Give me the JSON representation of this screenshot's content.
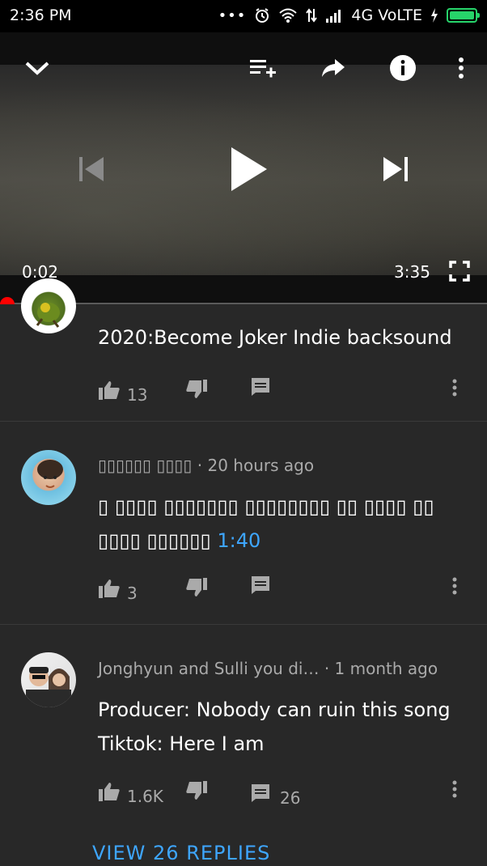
{
  "status": {
    "time": "2:36 PM",
    "network": "4G VoLTE",
    "icons": [
      "dots-icon",
      "alarm-icon",
      "wifi-icon",
      "data-arrows-icon",
      "signal-icon",
      "charging-icon",
      "battery-icon"
    ]
  },
  "player": {
    "elapsed": "0:02",
    "duration": "3:35",
    "progress_fraction": 0.01,
    "accent": "#ff0000",
    "icons": [
      "collapse-chevron-icon",
      "add-to-queue-icon",
      "share-icon",
      "info-icon",
      "more-vert-icon",
      "previous-icon",
      "play-icon",
      "next-icon",
      "fullscreen-icon"
    ]
  },
  "comments": [
    {
      "author": "",
      "age": "",
      "text": "2020:Become Joker Indie backsound",
      "likes": "13",
      "replies": ""
    },
    {
      "author": "▯▯▯▯▯▯ ▯▯▯▯",
      "age": "· 20 hours ago",
      "text": "▯ ▯▯▯▯ ▯▯▯▯▯▯▯ ▯▯▯▯▯▯▯▯ ▯▯ ▯▯▯▯ ▯▯ ▯▯▯▯ ▯▯▯▯▯▯",
      "timestamp_link": "1:40",
      "likes": "3",
      "replies": ""
    },
    {
      "author": "Jonghyun and Sulli you di…",
      "age": "· 1 month ago",
      "text_line1": "Producer: Nobody can ruin this song",
      "text_line2": "Tiktok: Here I am",
      "likes": "1.6K",
      "replies": "26"
    }
  ],
  "view_replies": "VIEW 26 REPLIES",
  "colors": {
    "background": "#282828",
    "link": "#3ea6ff",
    "secondary_text": "#aaaaaa"
  }
}
